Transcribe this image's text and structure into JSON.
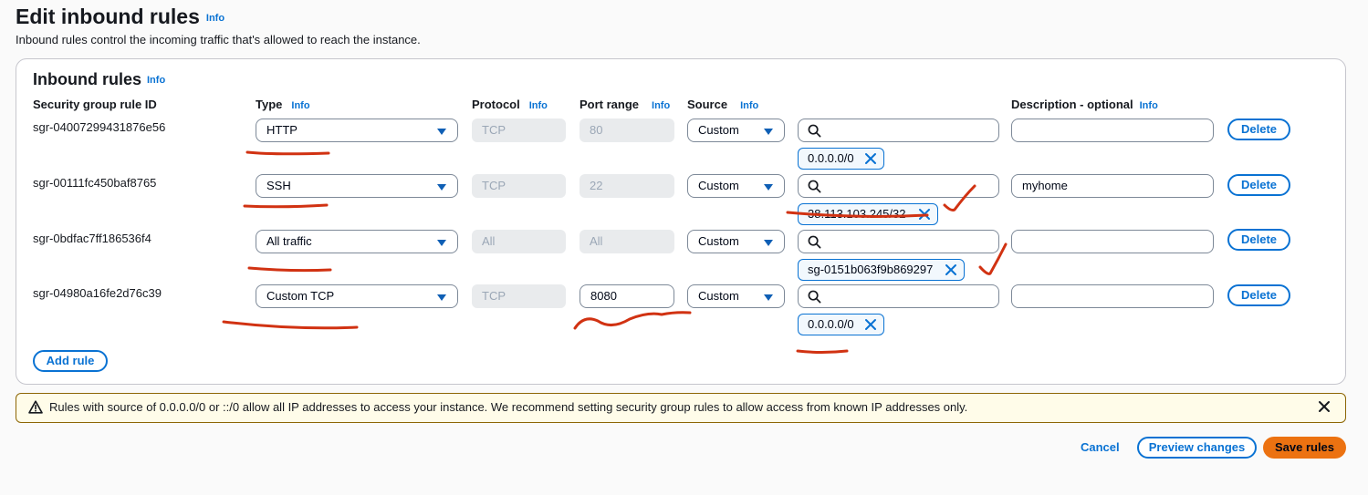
{
  "page": {
    "title": "Edit inbound rules",
    "title_info": "Info",
    "description": "Inbound rules control the incoming traffic that's allowed to reach the instance."
  },
  "container": {
    "title": "Inbound rules",
    "info": "Info"
  },
  "columns": {
    "rule_id": "Security group rule ID",
    "type": "Type",
    "protocol": "Protocol",
    "port_range": "Port range",
    "source": "Source",
    "description": "Description - optional",
    "info": "Info"
  },
  "rules": [
    {
      "id": "sgr-04007299431876e56",
      "type": "HTTP",
      "protocol": "TCP",
      "port_range": "80",
      "source": "Custom",
      "search_value": "",
      "token": "0.0.0.0/0",
      "description": "",
      "delete_label": "Delete"
    },
    {
      "id": "sgr-00111fc450baf8765",
      "type": "SSH",
      "protocol": "TCP",
      "port_range": "22",
      "source": "Custom",
      "search_value": "",
      "token": "38.113.103.245/32",
      "description": "myhome",
      "delete_label": "Delete"
    },
    {
      "id": "sgr-0bdfac7ff186536f4",
      "type": "All traffic",
      "protocol": "All",
      "port_range": "All",
      "source": "Custom",
      "search_value": "",
      "token": "sg-0151b063f9b869297",
      "description": "",
      "delete_label": "Delete"
    },
    {
      "id": "sgr-04980a16fe2d76c39",
      "type": "Custom TCP",
      "protocol": "TCP",
      "port_range": "8080",
      "source": "Custom",
      "search_value": "",
      "token": "0.0.0.0/0",
      "description": "",
      "delete_label": "Delete"
    }
  ],
  "add_rule_label": "Add rule",
  "alert": {
    "text": "Rules with source of 0.0.0.0/0 or ::/0 allow all IP addresses to access your instance. We recommend setting security group rules to allow access from known IP addresses only.",
    "icon": "warning-icon"
  },
  "footer": {
    "cancel_label": "Cancel",
    "preview_label": "Preview changes",
    "save_label": "Save rules"
  },
  "colors": {
    "link": "#0972d3",
    "primary_button": "#ec7211",
    "annotation": "#d13212",
    "alert_background": "#fffce9"
  }
}
